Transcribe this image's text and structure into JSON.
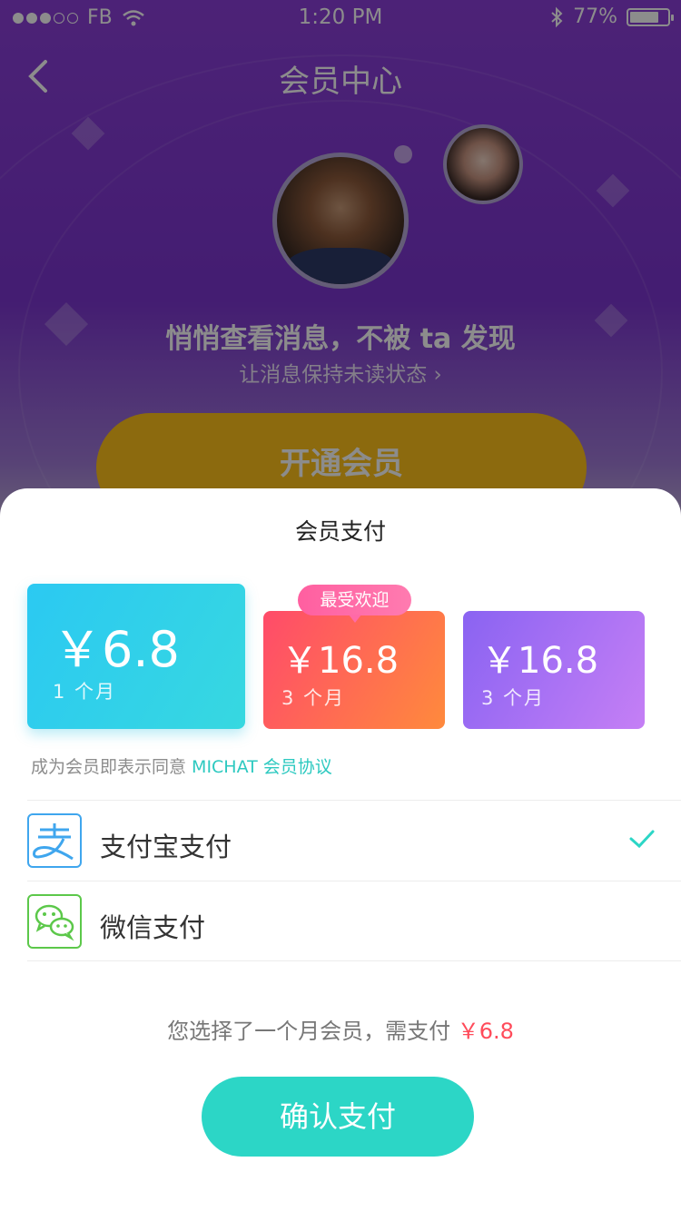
{
  "status_bar": {
    "carrier": "FB",
    "time": "1:20 PM",
    "battery": "77%",
    "battery_level": 0.77
  },
  "header": {
    "title": "会员中心"
  },
  "feature": {
    "title": "悄悄查看消息，不被 ta 发现",
    "subtitle": "让消息保持未读状态 ›"
  },
  "open_button": {
    "label": "开通会员"
  },
  "sheet": {
    "title": "会员支付",
    "popular_badge": "最受欢迎",
    "plans": [
      {
        "price": "￥6.8",
        "duration": "1 个月",
        "selected": true
      },
      {
        "price": "￥16.8",
        "duration": "3 个月",
        "selected": false
      },
      {
        "price": "￥16.8",
        "duration": "3 个月",
        "selected": false
      }
    ],
    "agreement": {
      "prefix": "成为会员即表示同意 ",
      "link": "MICHAT 会员协议"
    },
    "payment_methods": [
      {
        "label": "支付宝支付",
        "icon": "alipay-icon",
        "selected": true
      },
      {
        "label": "微信支付",
        "icon": "wechat-icon",
        "selected": false
      }
    ],
    "summary": {
      "prefix": "您选择了一个月会员，需支付 ",
      "amount": "￥6.8"
    },
    "confirm_label": "确认支付"
  },
  "colors": {
    "accent": "#2cd6c6",
    "alipay": "#3fa6ee",
    "wechat": "#5cc84a",
    "price_red": "#ff4b5a",
    "purple_bg": "#8b3fd9"
  }
}
